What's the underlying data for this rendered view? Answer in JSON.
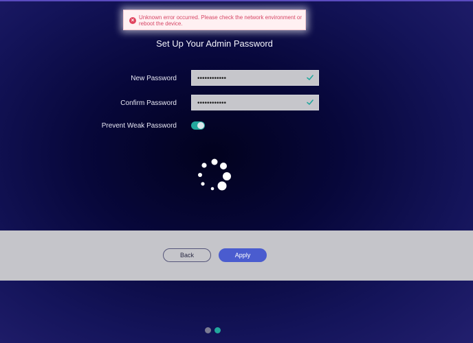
{
  "toast": {
    "icon": "error-circle-icon",
    "message": "Unknown error occurred. Please check the network environment or reboot the device."
  },
  "form": {
    "title": "Set Up Your Admin Password",
    "new_password": {
      "label": "New Password",
      "value": "••••••••••••",
      "status_icon": "check-icon"
    },
    "confirm_password": {
      "label": "Confirm Password",
      "value": "••••••••••••",
      "status_icon": "check-icon"
    },
    "prevent_weak": {
      "label": "Prevent Weak Password",
      "enabled": true
    }
  },
  "loading": {
    "icon": "loading-spinner-icon"
  },
  "footer": {
    "back_label": "Back",
    "apply_label": "Apply"
  },
  "pagination": {
    "pages": 2,
    "current": 2
  },
  "colors": {
    "accent": "#22a79d",
    "apply_button": "#4a5ccf",
    "error_text": "#d64565",
    "error_bg": "#fff0f2",
    "pager_inactive": "#7a7a92"
  }
}
